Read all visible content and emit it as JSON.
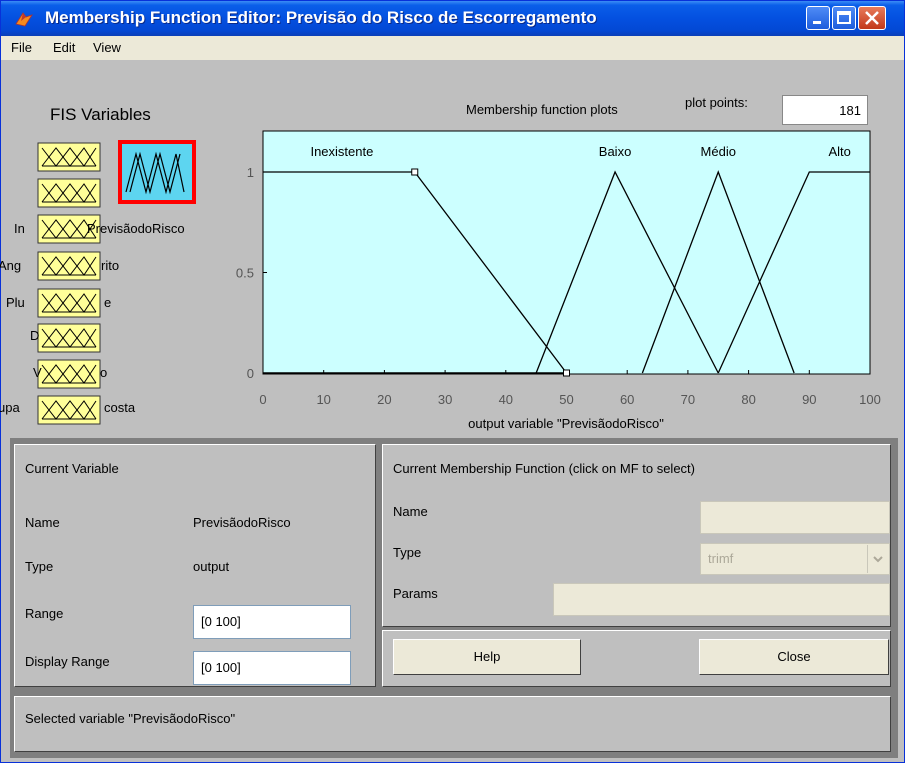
{
  "window": {
    "title": "Membership Function Editor: Previsão do Risco de Escorregamento"
  },
  "menu": [
    "File",
    "Edit",
    "View"
  ],
  "fis": {
    "title": "FIS Variables",
    "input_labels": [
      "In",
      "PrevisãodoRisco",
      "Ang",
      "rito",
      "Plu",
      "e",
      "D",
      "V",
      "o",
      "upa",
      "costa"
    ],
    "selected": "PrevisãodoRisco"
  },
  "plot": {
    "title": "Membership function plots",
    "plot_points_label": "plot points:",
    "plot_points_value": "181"
  },
  "chart_data": {
    "type": "line",
    "xlabel": "output variable \"PrevisãodoRisco\"",
    "xlim": [
      0,
      100
    ],
    "ylim": [
      0,
      1
    ],
    "xticks": [
      0,
      10,
      20,
      30,
      40,
      50,
      60,
      70,
      80,
      90,
      100
    ],
    "yticks": [
      0,
      0.5,
      1
    ],
    "series": [
      {
        "name": "Inexistente",
        "x": [
          0,
          25,
          50
        ],
        "y": [
          1,
          1,
          0
        ]
      },
      {
        "name": "Baixo",
        "x": [
          45,
          58,
          75
        ],
        "y": [
          0,
          1,
          0
        ]
      },
      {
        "name": "Médio",
        "x": [
          62.5,
          75,
          87.5
        ],
        "y": [
          0,
          1,
          0
        ]
      },
      {
        "name": "Alto",
        "x": [
          75,
          90,
          100
        ],
        "y": [
          0,
          1,
          1
        ]
      }
    ],
    "selected_line": {
      "x": [
        0,
        50
      ],
      "y": [
        0,
        0
      ]
    }
  },
  "current_variable": {
    "title": "Current Variable",
    "name_label": "Name",
    "name_value": "PrevisãodoRisco",
    "type_label": "Type",
    "type_value": "output",
    "range_label": "Range",
    "range_value": "[0 100]",
    "display_range_label": "Display Range",
    "display_range_value": "[0 100]"
  },
  "current_mf": {
    "title": "Current Membership Function (click on MF to select)",
    "name_label": "Name",
    "type_label": "Type",
    "type_value": "trimf",
    "params_label": "Params"
  },
  "buttons": {
    "help": "Help",
    "close": "Close"
  },
  "status": "Selected variable \"PrevisãodoRisco\"",
  "colors": {
    "plot_bg": "#ccffff",
    "var_box": "#ffff99",
    "selected_border": "#ff0000",
    "titlebar": "#0450e0"
  }
}
